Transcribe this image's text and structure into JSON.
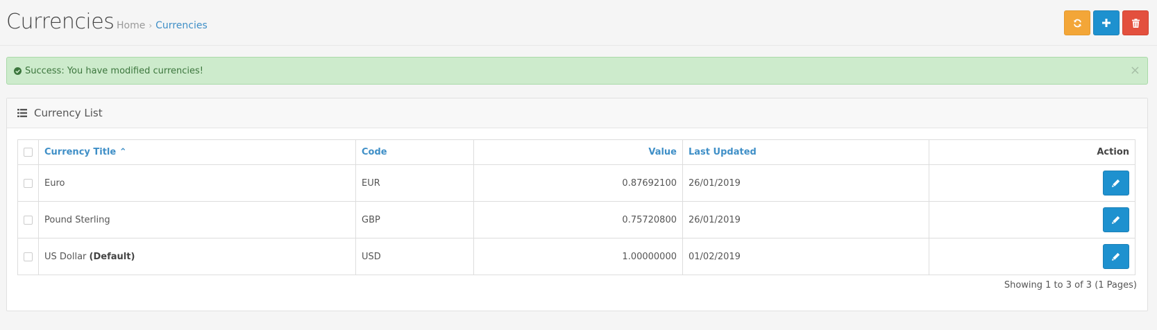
{
  "header": {
    "title": "Currencies",
    "breadcrumb": [
      {
        "label": "Home"
      },
      {
        "label": "Currencies"
      }
    ]
  },
  "toolbar": {
    "refresh_color": "#f3a638",
    "add_color": "#1e91cf",
    "delete_color": "#e3503e"
  },
  "alert": {
    "message": "Success: You have modified currencies!",
    "close": "×"
  },
  "panel": {
    "title": "Currency List"
  },
  "table": {
    "columns": {
      "title": "Currency Title",
      "code": "Code",
      "value": "Value",
      "last_updated": "Last Updated",
      "action": "Action"
    },
    "rows": [
      {
        "title": "Euro",
        "suffix": "",
        "code": "EUR",
        "value": "0.87692100",
        "updated": "26/01/2019"
      },
      {
        "title": "Pound Sterling",
        "suffix": "",
        "code": "GBP",
        "value": "0.75720800",
        "updated": "26/01/2019"
      },
      {
        "title": "US Dollar",
        "suffix": "(Default)",
        "code": "USD",
        "value": "1.00000000",
        "updated": "01/02/2019"
      }
    ]
  },
  "pagination": {
    "text": "Showing 1 to 3 of 3 (1 Pages)"
  }
}
